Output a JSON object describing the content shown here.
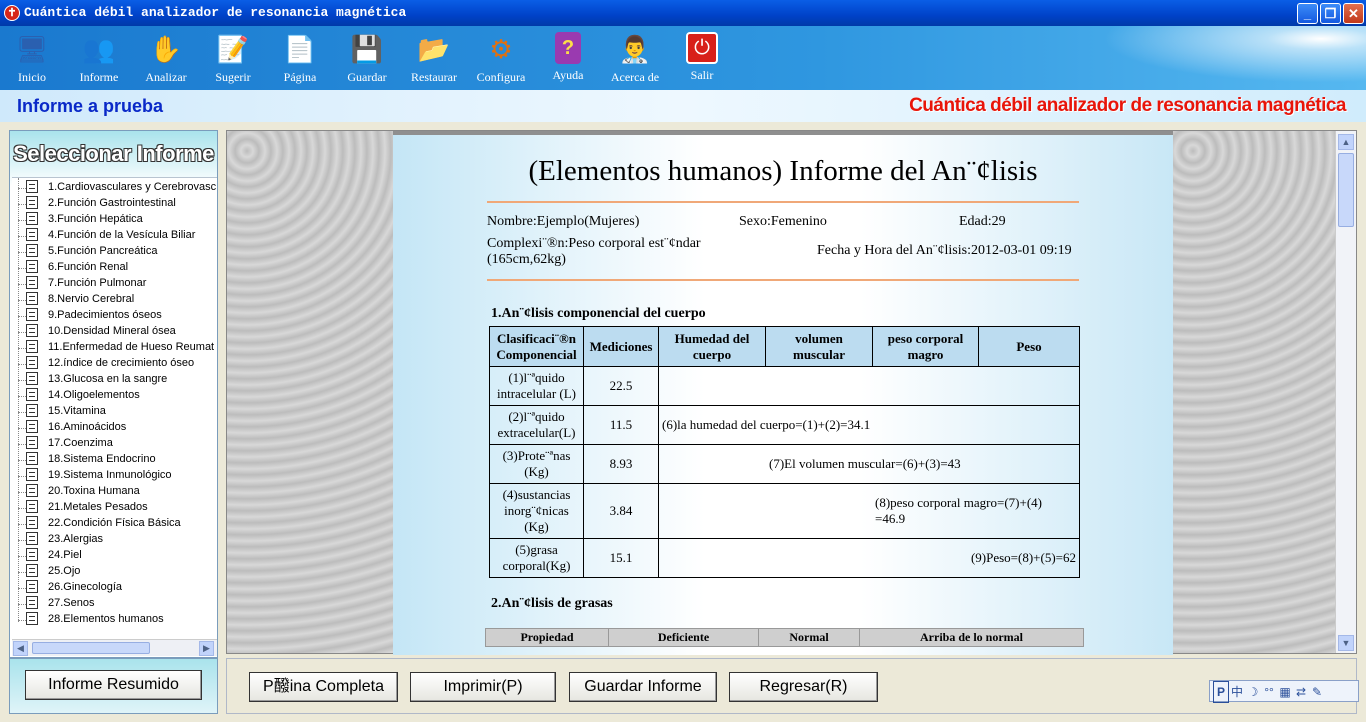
{
  "window": {
    "title": "Cuántica débil analizador de resonancia magnética",
    "controls": {
      "minimize": "_",
      "maximize": "❐",
      "close": "✕"
    }
  },
  "toolbar": {
    "buttons": [
      {
        "label": "Inicio",
        "icon": "monitor-icon"
      },
      {
        "label": "Informe",
        "icon": "users-icon"
      },
      {
        "label": "Analizar",
        "icon": "hand-icon"
      },
      {
        "label": "Sugerir",
        "icon": "document-pen-icon"
      },
      {
        "label": "Página",
        "icon": "page-edit-icon"
      },
      {
        "label": "Guardar",
        "icon": "save-icon"
      },
      {
        "label": "Restaurar",
        "icon": "restore-icon"
      },
      {
        "label": "Configura",
        "icon": "gears-icon"
      },
      {
        "label": "Ayuda",
        "icon": "help-book-icon"
      },
      {
        "label": "Acerca de",
        "icon": "about-person-icon"
      },
      {
        "label": "Salir",
        "icon": "power-icon"
      }
    ]
  },
  "header": {
    "subtitle": "Informe a prueba",
    "brand": "Cuántica débil analizador de resonancia magnética"
  },
  "sidebar": {
    "heading": "Seleccionar Informe",
    "items": [
      "1.Cardiovasculares y Cerebrovasc",
      "2.Función Gastrointestinal",
      "3.Función Hepática",
      "4.Función de la Vesícula Biliar",
      "5.Función Pancreática",
      "6.Función Renal",
      "7.Función Pulmonar",
      "8.Nervio Cerebral",
      "9.Padecimientos óseos",
      "10.Densidad Mineral ósea",
      "11.Enfermedad de Hueso Reumat",
      "12.índice de crecimiento óseo",
      "13.Glucosa en la sangre",
      "14.Oligoelementos",
      "15.Vitamina",
      "16.Aminoácidos",
      "17.Coenzima",
      "18.Sistema Endocrino",
      "19.Sistema Inmunológico",
      "20.Toxina Humana",
      "21.Metales Pesados",
      "22.Condición Física Básica",
      "23.Alergias",
      "24.Piel",
      "25.Ojo",
      "26.Ginecología",
      "27.Senos",
      "28.Elementos humanos"
    ],
    "summary_button": "Informe Resumido"
  },
  "report": {
    "title": "(Elementos humanos) Informe del An¨¢lisis",
    "name": "Nombre:Ejemplo(Mujeres)",
    "sex": "Sexo:Femenino",
    "age": "Edad:29",
    "complexion_line1": "Complexi¨®n:Peso corporal est¨¢ndar",
    "complexion_line2": "(165cm,62kg)",
    "datetime": "Fecha y Hora del An¨¢lisis:2012-03-01 09:19",
    "section1": "1.An¨¢lisis componencial del cuerpo",
    "table1": {
      "headers": [
        "Clasificaci¨®n Componencial",
        "Mediciones",
        "Humedad del cuerpo",
        "volumen muscular",
        "peso corporal magro",
        "Peso"
      ],
      "rows": [
        {
          "label": "(1)l¨ªquido intracelular (L)",
          "value": "22.5",
          "note": ""
        },
        {
          "label": "(2)l¨ªquido extracelular(L)",
          "value": "11.5",
          "note": "(6)la humedad del cuerpo=(1)+(2)=34.1"
        },
        {
          "label": "(3)Prote¨ªnas (Kg)",
          "value": "8.93",
          "note": "(7)El volumen muscular=(6)+(3)=43"
        },
        {
          "label": "(4)sustancias inorg¨¢nicas (Kg)",
          "value": "3.84",
          "note": "(8)peso corporal magro=(7)+(4) =46.9"
        },
        {
          "label": "(5)grasa corporal(Kg)",
          "value": "15.1",
          "note": "(9)Peso=(8)+(5)=62"
        }
      ]
    },
    "section2": "2.An¨¢lisis de grasas",
    "table2": {
      "headers": [
        "Propiedad",
        "Deficiente",
        "Normal",
        "Arriba de lo normal"
      ]
    }
  },
  "bottom": {
    "full_page": "P醱ina Completa",
    "print": "Imprimir(P)",
    "save": "Guardar Informe",
    "back": "Regresar(R)"
  },
  "ime": {
    "symbols": [
      "P",
      "中",
      "☽",
      "°°",
      "▦",
      "⇄",
      "✎"
    ]
  }
}
